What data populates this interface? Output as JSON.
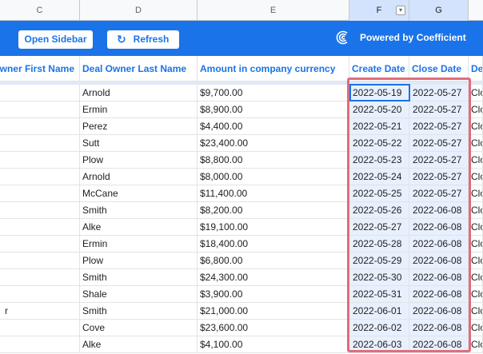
{
  "column_letters": [
    "C",
    "D",
    "E",
    "F",
    "G"
  ],
  "banner": {
    "open_sidebar_label": "Open Sidebar",
    "refresh_label": "Refresh",
    "refresh_icon": "↻",
    "powered_by": "Powered by Coefficient",
    "accent_color": "#1a73e8",
    "highlight_color": "#e06c7e"
  },
  "headers": {
    "first_name": "wner First Name",
    "last_name": "Deal Owner Last Name",
    "amount": "Amount in company currency",
    "create_date": "Create Date",
    "close_date": "Close Date",
    "next": "De"
  },
  "rows": [
    {
      "first": "",
      "last": "Arnold",
      "amount": "$9,700.00",
      "create": "2022-05-19",
      "close": "2022-05-27",
      "next": "Clo"
    },
    {
      "first": "",
      "last": "Ermin",
      "amount": "$8,900.00",
      "create": "2022-05-20",
      "close": "2022-05-27",
      "next": "Clo"
    },
    {
      "first": "",
      "last": "Perez",
      "amount": "$4,400.00",
      "create": "2022-05-21",
      "close": "2022-05-27",
      "next": "Clo"
    },
    {
      "first": "",
      "last": "Sutt",
      "amount": "$23,400.00",
      "create": "2022-05-22",
      "close": "2022-05-27",
      "next": "Clo"
    },
    {
      "first": "",
      "last": "Plow",
      "amount": "$8,800.00",
      "create": "2022-05-23",
      "close": "2022-05-27",
      "next": "Clo"
    },
    {
      "first": "",
      "last": "Arnold",
      "amount": "$8,000.00",
      "create": "2022-05-24",
      "close": "2022-05-27",
      "next": "Clo"
    },
    {
      "first": "",
      "last": "McCane",
      "amount": "$11,400.00",
      "create": "2022-05-25",
      "close": "2022-05-27",
      "next": "Clo"
    },
    {
      "first": "",
      "last": "Smith",
      "amount": "$8,200.00",
      "create": "2022-05-26",
      "close": "2022-06-08",
      "next": "Clo"
    },
    {
      "first": "",
      "last": "Alke",
      "amount": "$19,100.00",
      "create": "2022-05-27",
      "close": "2022-06-08",
      "next": "Clo"
    },
    {
      "first": "",
      "last": "Ermin",
      "amount": "$18,400.00",
      "create": "2022-05-28",
      "close": "2022-06-08",
      "next": "Clo"
    },
    {
      "first": "",
      "last": "Plow",
      "amount": "$6,800.00",
      "create": "2022-05-29",
      "close": "2022-06-08",
      "next": "Clo"
    },
    {
      "first": "",
      "last": "Smith",
      "amount": "$24,300.00",
      "create": "2022-05-30",
      "close": "2022-06-08",
      "next": "Clo"
    },
    {
      "first": "",
      "last": "Shale",
      "amount": "$3,900.00",
      "create": "2022-05-31",
      "close": "2022-06-08",
      "next": "Clo"
    },
    {
      "first": "r",
      "last": "Smith",
      "amount": "$21,000.00",
      "create": "2022-06-01",
      "close": "2022-06-08",
      "next": "Clo"
    },
    {
      "first": "",
      "last": "Cove",
      "amount": "$23,600.00",
      "create": "2022-06-02",
      "close": "2022-06-08",
      "next": "Clo"
    },
    {
      "first": "",
      "last": "Alke",
      "amount": "$4,100.00",
      "create": "2022-06-03",
      "close": "2022-06-08",
      "next": "Clo"
    }
  ]
}
